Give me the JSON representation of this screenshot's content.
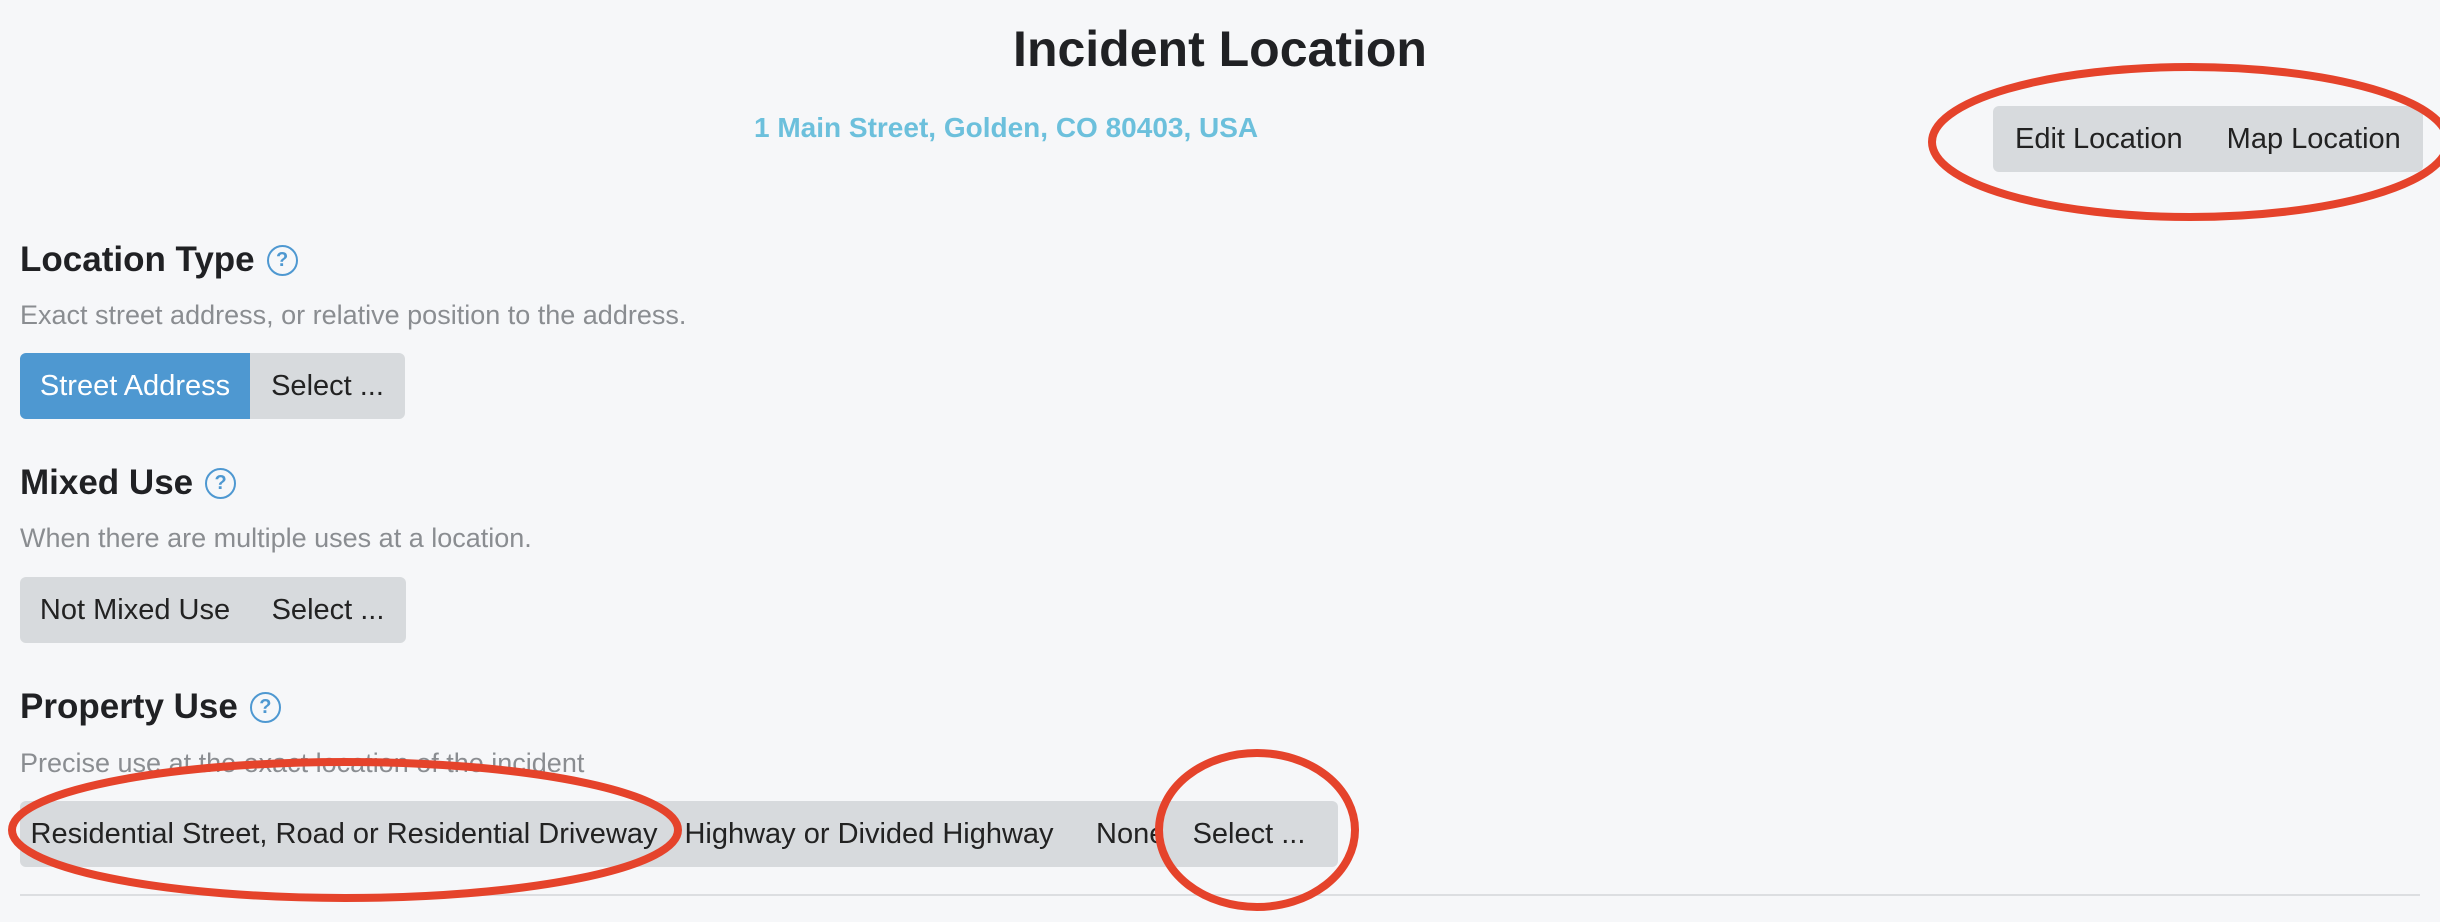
{
  "page": {
    "title": "Incident Location",
    "address": "1 Main Street, Golden, CO 80403, USA"
  },
  "location_actions": {
    "edit": "Edit Location",
    "map": "Map Location"
  },
  "location_type": {
    "title": "Location Type",
    "description": "Exact street address, or relative position to the address.",
    "options": [
      "Street Address",
      "Select ..."
    ],
    "selected": "Street Address"
  },
  "mixed_use": {
    "title": "Mixed Use",
    "description": "When there are multiple uses at a location.",
    "options": [
      "Not Mixed Use",
      "Select ..."
    ]
  },
  "property_use": {
    "title": "Property Use",
    "description": "Precise use at the exact location of the incident",
    "options": [
      "Residential Street, Road or Residential Driveway",
      "Highway or Divided Highway",
      "None",
      "Select ..."
    ]
  },
  "help_glyph": "?",
  "colors": {
    "accent": "#4e98d1",
    "address": "#6cc0dc",
    "annotation": "#e5432b"
  }
}
